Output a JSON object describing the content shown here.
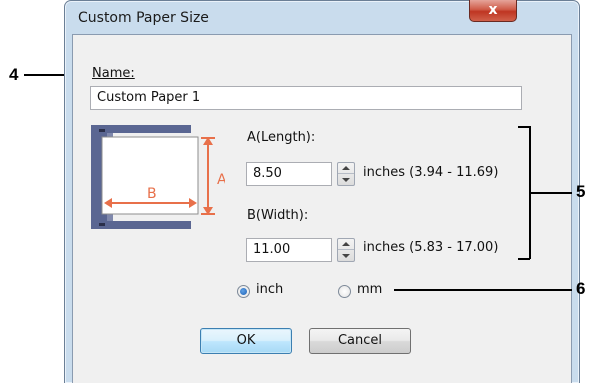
{
  "window": {
    "title": "Custom Paper Size",
    "close_symbol": "x"
  },
  "name": {
    "label": "Name:",
    "value": "Custom Paper 1"
  },
  "diagram": {
    "label_a": "A",
    "label_b": "B",
    "accent_color": "#e8704a"
  },
  "length": {
    "label": "A(Length):",
    "value": "8.50",
    "range": "inches (3.94 - 11.69)"
  },
  "width": {
    "label": "B(Width):",
    "value": "11.00",
    "range": "inches (5.83 - 17.00)"
  },
  "units": {
    "inch": "inch",
    "mm": "mm",
    "selected": "inch"
  },
  "buttons": {
    "ok": "OK",
    "cancel": "Cancel"
  },
  "callouts": {
    "n4": "4",
    "n5": "5",
    "n6": "6"
  }
}
